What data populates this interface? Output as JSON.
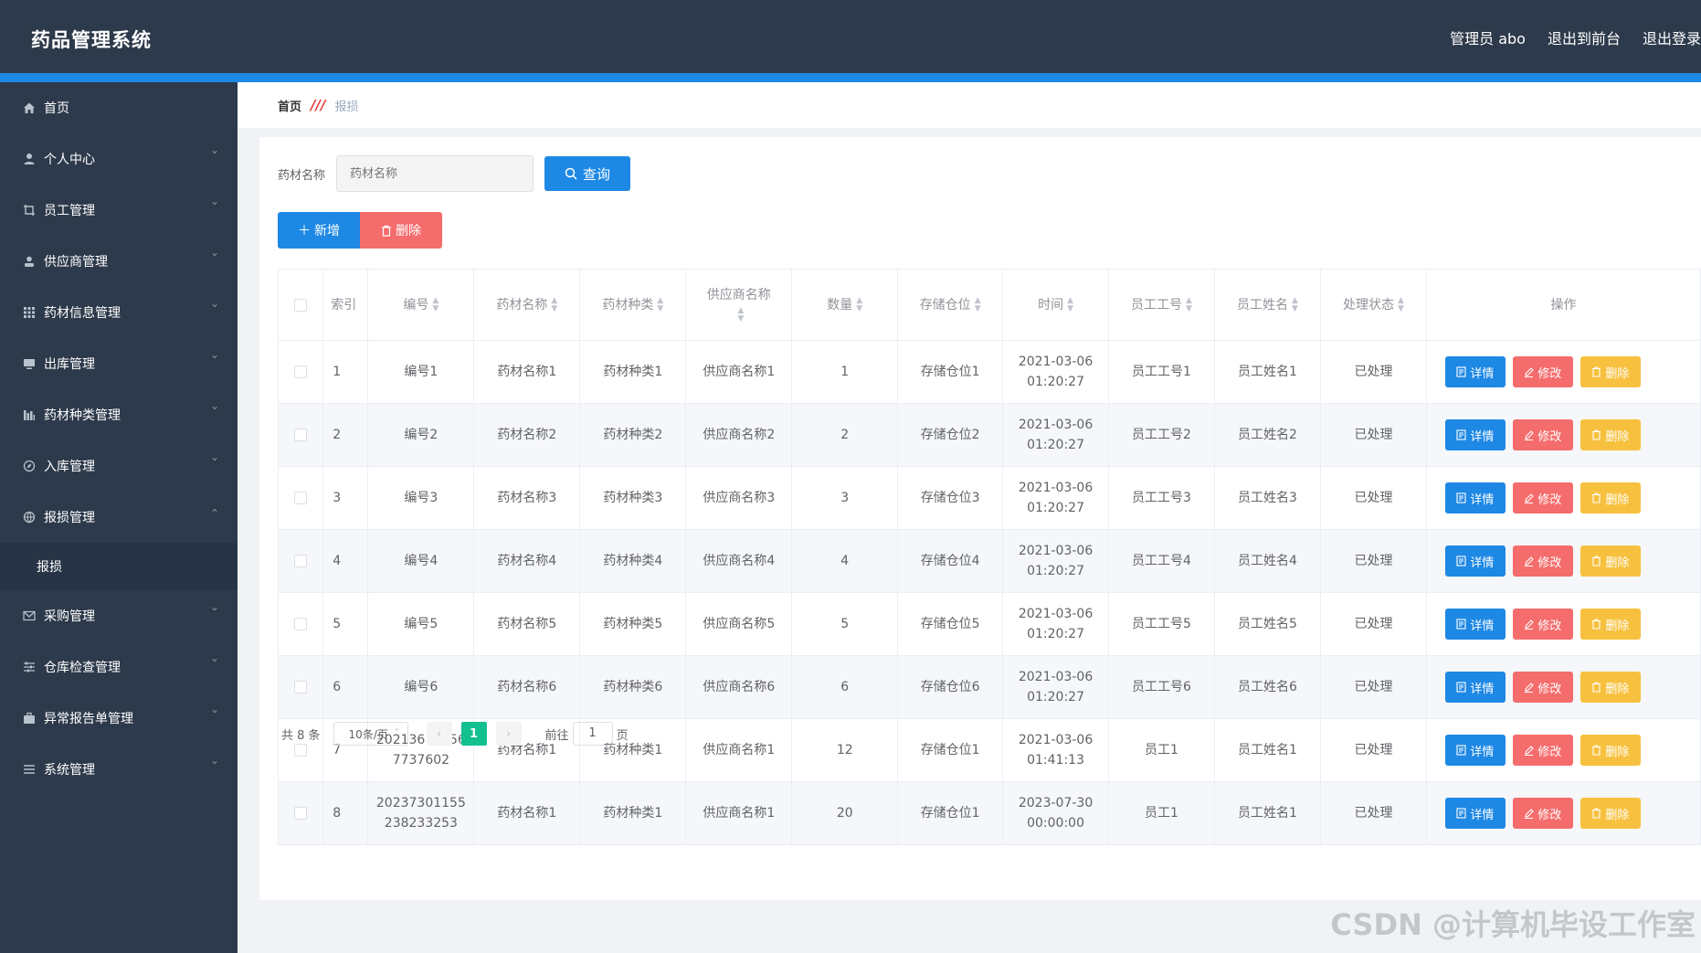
{
  "header": {
    "title": "药品管理系统",
    "user": "管理员 abo",
    "back_front": "退出到前台",
    "logout": "退出登录"
  },
  "sidebar": {
    "items": [
      {
        "label": "首页",
        "icon": "home-icon"
      },
      {
        "label": "个人中心",
        "icon": "user-icon"
      },
      {
        "label": "员工管理",
        "icon": "crop-icon"
      },
      {
        "label": "供应商管理",
        "icon": "person-icon"
      },
      {
        "label": "药材信息管理",
        "icon": "grid-icon"
      },
      {
        "label": "出库管理",
        "icon": "monitor-icon"
      },
      {
        "label": "药材种类管理",
        "icon": "chart-icon"
      },
      {
        "label": "入库管理",
        "icon": "compass-icon"
      },
      {
        "label": "报损管理",
        "icon": "globe-icon"
      },
      {
        "label": "采购管理",
        "icon": "mail-icon"
      },
      {
        "label": "仓库检查管理",
        "icon": "sliders-icon"
      },
      {
        "label": "异常报告单管理",
        "icon": "briefcase-icon"
      },
      {
        "label": "系统管理",
        "icon": "menu-icon"
      }
    ],
    "sub_item": "报损"
  },
  "breadcrumb": {
    "home": "首页",
    "separator": "///",
    "current": "报损"
  },
  "search": {
    "label": "药材名称",
    "placeholder": "药材名称",
    "button": "查询"
  },
  "actions": {
    "add": "新增",
    "delete": "删除"
  },
  "table": {
    "headers": {
      "index": "索引",
      "code": "编号",
      "name": "药材名称",
      "category": "药材种类",
      "supplier": "供应商名称",
      "qty": "数量",
      "location": "存储仓位",
      "time": "时间",
      "emp_no": "员工工号",
      "emp_name": "员工姓名",
      "status": "处理状态",
      "ops": "操作"
    },
    "op_labels": {
      "detail": "详情",
      "edit": "修改",
      "remove": "删除"
    },
    "rows": [
      {
        "idx": "1",
        "code": "编号1",
        "name": "药材名称1",
        "category": "药材种类1",
        "supplier": "供应商名称1",
        "qty": "1",
        "location": "存储仓位1",
        "date": "2021-03-06",
        "clock": "01:20:27",
        "emp_no": "员工工号1",
        "emp_name": "员工姓名1",
        "status": "已处理"
      },
      {
        "idx": "2",
        "code": "编号2",
        "name": "药材名称2",
        "category": "药材种类2",
        "supplier": "供应商名称2",
        "qty": "2",
        "location": "存储仓位2",
        "date": "2021-03-06",
        "clock": "01:20:27",
        "emp_no": "员工工号2",
        "emp_name": "员工姓名2",
        "status": "已处理"
      },
      {
        "idx": "3",
        "code": "编号3",
        "name": "药材名称3",
        "category": "药材种类3",
        "supplier": "供应商名称3",
        "qty": "3",
        "location": "存储仓位3",
        "date": "2021-03-06",
        "clock": "01:20:27",
        "emp_no": "员工工号3",
        "emp_name": "员工姓名3",
        "status": "已处理"
      },
      {
        "idx": "4",
        "code": "编号4",
        "name": "药材名称4",
        "category": "药材种类4",
        "supplier": "供应商名称4",
        "qty": "4",
        "location": "存储仓位4",
        "date": "2021-03-06",
        "clock": "01:20:27",
        "emp_no": "员工工号4",
        "emp_name": "员工姓名4",
        "status": "已处理"
      },
      {
        "idx": "5",
        "code": "编号5",
        "name": "药材名称5",
        "category": "药材种类5",
        "supplier": "供应商名称5",
        "qty": "5",
        "location": "存储仓位5",
        "date": "2021-03-06",
        "clock": "01:20:27",
        "emp_no": "员工工号5",
        "emp_name": "员工姓名5",
        "status": "已处理"
      },
      {
        "idx": "6",
        "code": "编号6",
        "name": "药材名称6",
        "category": "药材种类6",
        "supplier": "供应商名称6",
        "qty": "6",
        "location": "存储仓位6",
        "date": "2021-03-06",
        "clock": "01:20:27",
        "emp_no": "员工工号6",
        "emp_name": "员工姓名6",
        "status": "已处理"
      },
      {
        "idx": "7",
        "code": "20213614156\n7737602",
        "name": "药材名称1",
        "category": "药材种类1",
        "supplier": "供应商名称1",
        "qty": "12",
        "location": "存储仓位1",
        "date": "2021-03-06",
        "clock": "01:41:13",
        "emp_no": "员工1",
        "emp_name": "员工姓名1",
        "status": "已处理"
      },
      {
        "idx": "8",
        "code": "20237301155\n238233253",
        "name": "药材名称1",
        "category": "药材种类1",
        "supplier": "供应商名称1",
        "qty": "20",
        "location": "存储仓位1",
        "date": "2023-07-30",
        "clock": "00:00:00",
        "emp_no": "员工1",
        "emp_name": "员工姓名1",
        "status": "已处理"
      }
    ]
  },
  "pagination": {
    "total": "共 8 条",
    "page_size": "10条/页",
    "current_page": "1",
    "goto_label": "前往",
    "goto_value": "1",
    "page_suffix": "页"
  },
  "watermark": "CSDN @计算机毕设工作室",
  "colors": {
    "header_bg": "#2d3a4b",
    "accent_blue": "#1e88e5",
    "danger": "#f56c6c",
    "warning": "#f7c13f",
    "pager_active": "#13c08f"
  }
}
